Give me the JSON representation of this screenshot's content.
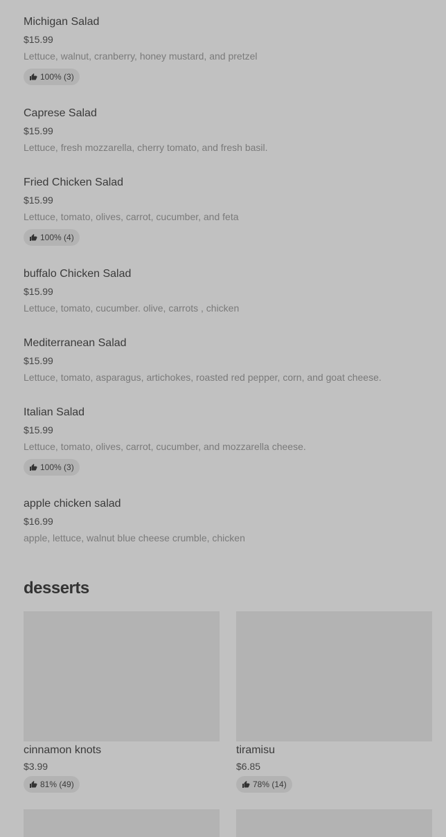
{
  "menu_items": [
    {
      "name": "Michigan Salad",
      "price": "$15.99",
      "description": "Lettuce, walnut, cranberry, honey mustard, and pretzel",
      "rating": "100% (3)"
    },
    {
      "name": "Caprese Salad",
      "price": "$15.99",
      "description": "Lettuce, fresh mozzarella, cherry tomato, and fresh basil.",
      "rating": null
    },
    {
      "name": "Fried Chicken Salad",
      "price": "$15.99",
      "description": "Lettuce, tomato, olives, carrot, cucumber, and feta",
      "rating": "100% (4)"
    },
    {
      "name": "buffalo Chicken Salad",
      "price": "$15.99",
      "description": "Lettuce, tomato, cucumber. olive, carrots , chicken",
      "rating": null
    },
    {
      "name": "Mediterranean Salad",
      "price": "$15.99",
      "description": "Lettuce, tomato, asparagus, artichokes, roasted red pepper, corn, and goat cheese.",
      "rating": null
    },
    {
      "name": "Italian Salad",
      "price": "$15.99",
      "description": "Lettuce, tomato, olives, carrot, cucumber, and mozzarella cheese.",
      "rating": "100% (3)"
    },
    {
      "name": "apple chicken salad",
      "price": "$16.99",
      "description": "apple, lettuce, walnut blue cheese crumble, chicken",
      "rating": null
    }
  ],
  "desserts": {
    "title": "desserts",
    "items": [
      {
        "name": "cinnamon knots",
        "price": "$3.99",
        "rating": "81% (49)"
      },
      {
        "name": "tiramisu",
        "price": "$6.85",
        "rating": "78% (14)"
      }
    ]
  },
  "icons": {
    "rating": "thumbs-up-icon"
  },
  "colors": {
    "background": "#c1c1c1",
    "placeholder": "#b3b3b3",
    "pill": "#b3b3b3"
  }
}
